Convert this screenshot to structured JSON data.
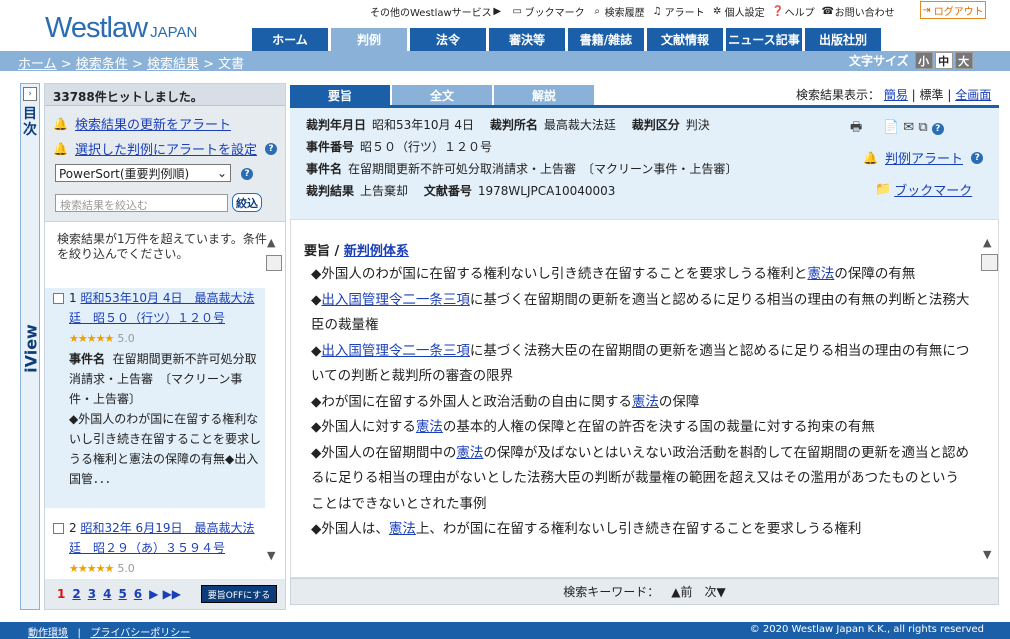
{
  "header": {
    "logo_main": "Westlaw",
    "logo_sub": "JAPAN",
    "utils": [
      {
        "label": "その他のWestlawサービス",
        "icon": "play-circle-icon"
      },
      {
        "label": "ブックマーク",
        "icon": "folder-icon"
      },
      {
        "label": "検索履歴",
        "icon": "search-icon"
      },
      {
        "label": "アラート",
        "icon": "bell-icon"
      },
      {
        "label": "個人設定",
        "icon": "gear-icon"
      },
      {
        "label": "ヘルプ",
        "icon": "help-icon"
      },
      {
        "label": "お問い合わせ",
        "icon": "phone-icon"
      }
    ],
    "logout": "ログアウト",
    "tabs": [
      "ホーム",
      "判例",
      "法令",
      "審決等",
      "書籍/雑誌",
      "文献情報",
      "ニュース記事",
      "出版社別"
    ],
    "active_tab": "判例",
    "breadcrumb": [
      "ホーム",
      "検索条件",
      "検索結果",
      "文書"
    ],
    "fontsize_label": "文字サイズ",
    "fontsize_opts": [
      "小",
      "中",
      "大"
    ]
  },
  "toc": {
    "label": "目次",
    "iview": "iView"
  },
  "left": {
    "hits": "33788件ヒットしました。",
    "alert_update": "検索結果の更新をアラート",
    "alert_selected": "選択した判例にアラートを設定",
    "sort_value": "PowerSort(重要判例順)",
    "narrow_placeholder": "検索結果を絞込む",
    "narrow_button": "絞込",
    "notice": "検索結果が1万件を超えています。条件を絞り込んでください。",
    "items": [
      {
        "num": "1",
        "title": "昭和53年10月 4日　最高裁大法廷　昭５０（行ツ）１２０号",
        "stars": "★★★★★",
        "rating": "5.0",
        "case_label": "事件名",
        "case_name": "在留期間更新不許可処分取消請求・上告審　〔マクリーン事件・上告審〕",
        "summary": "◆外国人のわが国に在留する権利ないし引き続き在留することを要求しうる権利と憲法の保障の有無◆出入国管．．．"
      },
      {
        "num": "2",
        "title": "昭和32年 6月19日　最高裁大法廷　昭２９（あ）３５９４号",
        "stars": "★★★★★",
        "rating": "5.0"
      }
    ],
    "pages": [
      "1",
      "2",
      "3",
      "4",
      "5",
      "6"
    ],
    "current_page": "1",
    "pager_next": "▶ ▶▶",
    "youshi_off": "要旨OFFにする"
  },
  "main": {
    "doc_tabs": [
      "要旨",
      "全文",
      "解説"
    ],
    "active_doc_tab": "要旨",
    "display_label": "検索結果表示：",
    "display_opts": [
      "簡易",
      "標準",
      "全画面"
    ],
    "meta": {
      "date_label": "裁判年月日",
      "date": "昭和53年10月 4日",
      "court_label": "裁判所名",
      "court": "最高裁大法廷",
      "type_label": "裁判区分",
      "type": "判決",
      "case_no_label": "事件番号",
      "case_no": "昭５０（行ツ）１２０号",
      "case_name_label": "事件名",
      "case_name": "在留期間更新不許可処分取消請求・上告審　〔マクリーン事件・上告審〕",
      "result_label": "裁判結果",
      "result": "上告棄却",
      "doc_no_label": "文献番号",
      "doc_no": "1978WLJPCA10040003"
    },
    "case_alert": "判例アラート",
    "bookmark": "ブックマーク",
    "body_head": "要旨",
    "body_link": "新判例体系",
    "body_paras": [
      "◆外国人のわが国に在留する権利ないし引き続き在留することを要求しうる権利と憲法の保障の有無",
      "◆出入国管理令二一条三項に基づく在留期間の更新を適当と認めるに足りる相当の理由の有無の判断と法務大臣の裁量権",
      "◆出入国管理令二一条三項に基づく法務大臣の在留期間の更新を適当と認めるに足りる相当の理由の有無についての判断と裁判所の審査の限界",
      "◆わが国に在留する外国人と政治活動の自由に関する憲法の保障",
      "◆外国人に対する憲法の基本的人権の保障と在留の許否を決する国の裁量に対する拘束の有無",
      "◆外国人の在留期間中の憲法の保障が及ばないとはいえない政治活動を斟酌して在留期間の更新を適当と認めるに足りる相当の理由がないとした法務大臣の判断が裁量権の範囲を超え又はその濫用があつたものということはできないとされた事例",
      "◆外国人は、憲法上、わが国に在留する権利ないし引き続き在留することを要求しうる権利"
    ],
    "keyword_label": "検索キーワード：",
    "kw_prev": "▲前",
    "kw_next": "次▼"
  },
  "footer": {
    "env": "動作環境",
    "privacy": "プライバシーポリシー",
    "copyright": "© 2020 Westlaw Japan K.K., all rights reserved"
  }
}
